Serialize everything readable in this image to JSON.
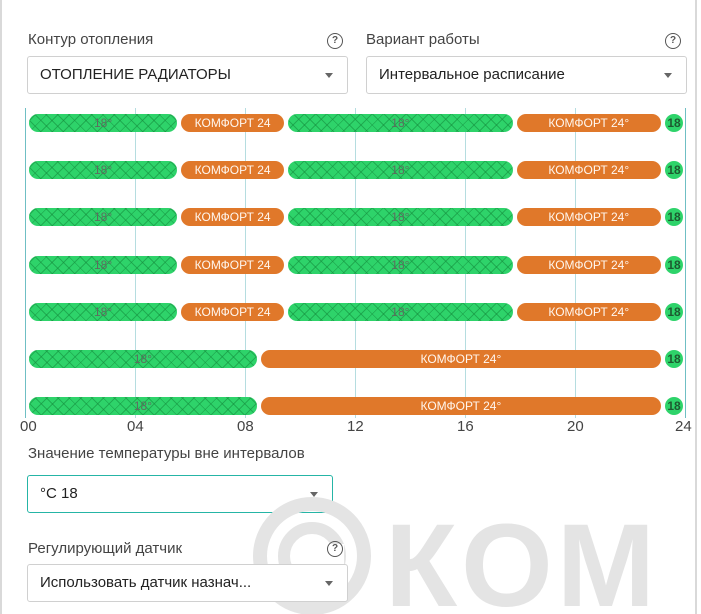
{
  "heating_circuit": {
    "label": "Контур отопления",
    "value": "ОТОПЛЕНИЕ РАДИАТОРЫ"
  },
  "work_mode": {
    "label": "Вариант работы",
    "value": "Интервальное расписание"
  },
  "schedule": {
    "rows": [
      {
        "segments": [
          {
            "kind": "eco",
            "label": "18°",
            "start": 0.15,
            "end": 5.6
          },
          {
            "kind": "comfort",
            "label": "КОМФОРТ 24",
            "start": 5.6,
            "end": 9.5
          },
          {
            "kind": "eco",
            "label": "18°",
            "start": 9.5,
            "end": 17.8
          },
          {
            "kind": "comfort",
            "label": "КОМФОРТ 24°",
            "start": 17.8,
            "end": 23.2
          },
          {
            "kind": "tail",
            "label": "18",
            "start": 23.2,
            "end": 24.0
          }
        ]
      },
      {
        "segments": [
          {
            "kind": "eco",
            "label": "18°",
            "start": 0.15,
            "end": 5.6
          },
          {
            "kind": "comfort",
            "label": "КОМФОРТ 24",
            "start": 5.6,
            "end": 9.5
          },
          {
            "kind": "eco",
            "label": "18°",
            "start": 9.5,
            "end": 17.8
          },
          {
            "kind": "comfort",
            "label": "КОМФОРТ 24°",
            "start": 17.8,
            "end": 23.2
          },
          {
            "kind": "tail",
            "label": "18",
            "start": 23.2,
            "end": 24.0
          }
        ]
      },
      {
        "segments": [
          {
            "kind": "eco",
            "label": "18°",
            "start": 0.15,
            "end": 5.6
          },
          {
            "kind": "comfort",
            "label": "КОМФОРТ 24",
            "start": 5.6,
            "end": 9.5
          },
          {
            "kind": "eco",
            "label": "18°",
            "start": 9.5,
            "end": 17.8
          },
          {
            "kind": "comfort",
            "label": "КОМФОРТ 24°",
            "start": 17.8,
            "end": 23.2
          },
          {
            "kind": "tail",
            "label": "18",
            "start": 23.2,
            "end": 24.0
          }
        ]
      },
      {
        "segments": [
          {
            "kind": "eco",
            "label": "18°",
            "start": 0.15,
            "end": 5.6
          },
          {
            "kind": "comfort",
            "label": "КОМФОРТ 24",
            "start": 5.6,
            "end": 9.5
          },
          {
            "kind": "eco",
            "label": "18°",
            "start": 9.5,
            "end": 17.8
          },
          {
            "kind": "comfort",
            "label": "КОМФОРТ 24°",
            "start": 17.8,
            "end": 23.2
          },
          {
            "kind": "tail",
            "label": "18",
            "start": 23.2,
            "end": 24.0
          }
        ]
      },
      {
        "segments": [
          {
            "kind": "eco",
            "label": "18°",
            "start": 0.15,
            "end": 5.6
          },
          {
            "kind": "comfort",
            "label": "КОМФОРТ 24",
            "start": 5.6,
            "end": 9.5
          },
          {
            "kind": "eco",
            "label": "18°",
            "start": 9.5,
            "end": 17.8
          },
          {
            "kind": "comfort",
            "label": "КОМФОРТ 24°",
            "start": 17.8,
            "end": 23.2
          },
          {
            "kind": "tail",
            "label": "18",
            "start": 23.2,
            "end": 24.0
          }
        ]
      },
      {
        "segments": [
          {
            "kind": "eco",
            "label": "18°",
            "start": 0.15,
            "end": 8.5
          },
          {
            "kind": "comfort",
            "label": "КОМФОРТ 24°",
            "start": 8.5,
            "end": 23.2
          },
          {
            "kind": "tail",
            "label": "18",
            "start": 23.2,
            "end": 24.0
          }
        ]
      },
      {
        "segments": [
          {
            "kind": "eco",
            "label": "18°",
            "start": 0.15,
            "end": 8.5
          },
          {
            "kind": "comfort",
            "label": "КОМФОРТ 24°",
            "start": 8.5,
            "end": 23.2
          },
          {
            "kind": "tail",
            "label": "18",
            "start": 23.2,
            "end": 24.0
          }
        ]
      }
    ],
    "hour_ticks": [
      {
        "hour": 0,
        "label": "00"
      },
      {
        "hour": 4,
        "label": "04"
      },
      {
        "hour": 8,
        "label": "08"
      },
      {
        "hour": 12,
        "label": "12"
      },
      {
        "hour": 16,
        "label": "16"
      },
      {
        "hour": 20,
        "label": "20"
      },
      {
        "hour": 24,
        "label": "24"
      }
    ]
  },
  "outside_temp": {
    "label": "Значение температуры вне интервалов",
    "value": "°C  18"
  },
  "sensor": {
    "label": "Регулирующий датчик",
    "value": "Использовать датчик назнач..."
  },
  "colors": {
    "eco": "#2ed36a",
    "comfort": "#e0782a",
    "focus": "#25b5a6"
  },
  "watermark": "©КОМ"
}
